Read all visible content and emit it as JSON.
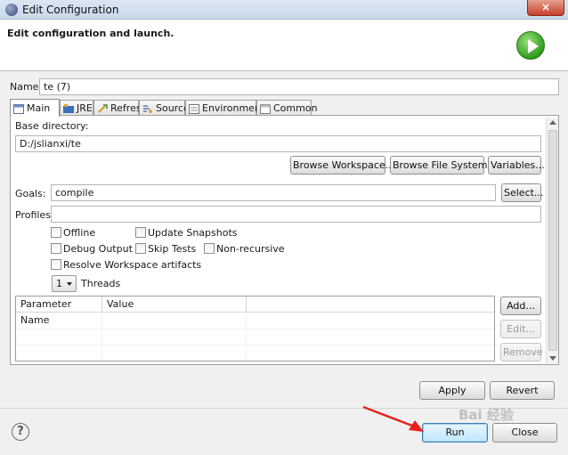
{
  "window": {
    "title": "Edit Configuration",
    "close_glyph": "×"
  },
  "header": {
    "title": "Edit configuration and launch.",
    "icon": "run-icon"
  },
  "name": {
    "label": "Name:",
    "value": "te (7)"
  },
  "tabs": [
    {
      "label": "Main",
      "icon": "main-tab-icon",
      "active": true
    },
    {
      "label": "JRE",
      "icon": "jre-icon"
    },
    {
      "label": "Refresh",
      "icon": "refresh-icon"
    },
    {
      "label": "Source",
      "icon": "source-icon"
    },
    {
      "label": "Environment",
      "icon": "environment-icon"
    },
    {
      "label": "Common",
      "icon": "common-icon"
    }
  ],
  "main": {
    "base_directory_label": "Base directory:",
    "base_directory_value": "D:/jslianxi/te",
    "browse_workspace": "Browse Workspace...",
    "browse_file_system": "Browse File System...",
    "variables": "Variables...",
    "goals_label": "Goals:",
    "goals_value": "compile",
    "select": "Select...",
    "profiles_label": "Profiles:",
    "profiles_value": "",
    "checkboxes": [
      {
        "label": "Offline",
        "checked": false
      },
      {
        "label": "Update Snapshots",
        "checked": false
      },
      {
        "label": "Debug Output",
        "checked": false
      },
      {
        "label": "Skip Tests",
        "checked": false
      },
      {
        "label": "Non-recursive",
        "checked": false
      },
      {
        "label": "Resolve Workspace artifacts",
        "checked": false
      }
    ],
    "threads_value": "1",
    "threads_label": "Threads",
    "params_table": {
      "columns": [
        "Parameter Name",
        "Value",
        ""
      ],
      "rows": []
    },
    "add": "Add...",
    "edit": "Edit...",
    "remove": "Remove"
  },
  "actions": {
    "apply": "Apply",
    "revert": "Revert",
    "run": "Run",
    "close": "Close",
    "help_glyph": "?"
  },
  "watermark": "Bai 经验"
}
